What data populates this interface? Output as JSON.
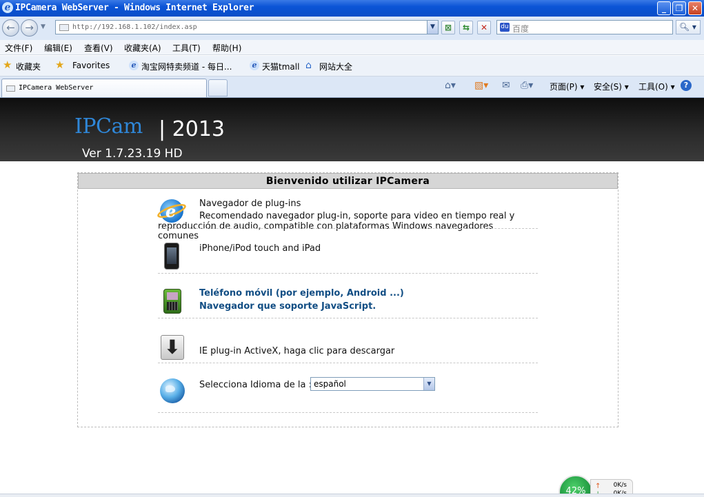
{
  "window": {
    "title": "IPCamera WebServer - Windows Internet Explorer"
  },
  "address": {
    "url": "http://192.168.1.102/index.asp",
    "search_placeholder": "百度"
  },
  "menu": [
    "文件(F)",
    "编辑(E)",
    "查看(V)",
    "收藏夹(A)",
    "工具(T)",
    "帮助(H)"
  ],
  "favorites": {
    "label": "收藏夹",
    "items": [
      "Favorites",
      "淘宝网特卖频道 - 每日...",
      "天猫tmall",
      "网站大全"
    ]
  },
  "tabs": [
    {
      "title": "IPCamera WebServer"
    }
  ],
  "commandbar": {
    "page": "页面(P)",
    "safety": "安全(S)",
    "tools": "工具(O)"
  },
  "banner": {
    "logo": "IPCam",
    "year": "| 2013",
    "version": "Ver 1.7.23.19 HD"
  },
  "panel": {
    "heading": "Bienvenido utilizar IPCamera",
    "plugin_title": "Navegador de plug-ins",
    "plugin_desc": "Recomendado navegador plug-in, soporte para video en tiempo real y reproducción de audio, compatible con plataformas Windows navegadores comunes",
    "iphone": "iPhone/iPod touch and iPad",
    "mobile_line1": "Teléfono móvil (por ejemplo, Android ...)",
    "mobile_line2": "Navegador que soporte JavaScript.",
    "activex": "IE plug-in ActiveX, haga clic para descargar",
    "language_label": "Selecciona Idioma de la :",
    "language_value": "español"
  },
  "speed": {
    "percent": "42%",
    "up": "0K/s",
    "down": "0K/s"
  },
  "colors": {
    "title_bar": "#0b54d6",
    "logo": "#2f87d8",
    "link_blue": "#124e84",
    "banner": "#1e1e1e"
  }
}
